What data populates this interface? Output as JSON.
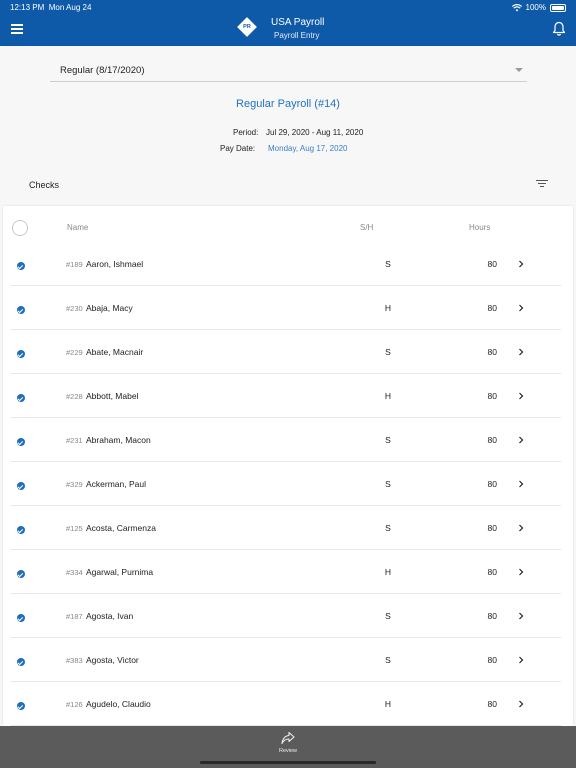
{
  "status_bar": {
    "time": "12:13 PM",
    "date": "Mon Aug 24",
    "battery": "100%"
  },
  "header": {
    "title": "USA Payroll",
    "subtitle": "Payroll Entry",
    "logo_text": "PR"
  },
  "payroll_select": {
    "value": "Regular (8/17/2020)"
  },
  "payroll": {
    "name": "Regular Payroll (#14)",
    "period_label": "Period:",
    "period_value": "Jul 29, 2020 - Aug 11, 2020",
    "paydate_label": "Pay Date:",
    "paydate_value": "Monday, Aug 17, 2020"
  },
  "checks": {
    "label": "Checks",
    "columns": {
      "name": "Name",
      "sh": "S/H",
      "hours": "Hours"
    },
    "rows": [
      {
        "id": "#189",
        "name": "Aaron, Ishmael",
        "sh": "S",
        "hours": "80"
      },
      {
        "id": "#230",
        "name": "Abaja, Macy",
        "sh": "H",
        "hours": "80"
      },
      {
        "id": "#229",
        "name": "Abate, Macnair",
        "sh": "S",
        "hours": "80"
      },
      {
        "id": "#228",
        "name": "Abbott, Mabel",
        "sh": "H",
        "hours": "80"
      },
      {
        "id": "#231",
        "name": "Abraham, Macon",
        "sh": "S",
        "hours": "80"
      },
      {
        "id": "#329",
        "name": "Ackerman, Paul",
        "sh": "S",
        "hours": "80"
      },
      {
        "id": "#125",
        "name": "Acosta, Carmenza",
        "sh": "S",
        "hours": "80"
      },
      {
        "id": "#334",
        "name": "Agarwal, Purnima",
        "sh": "H",
        "hours": "80"
      },
      {
        "id": "#187",
        "name": "Agosta, Ivan",
        "sh": "S",
        "hours": "80"
      },
      {
        "id": "#383",
        "name": "Agosta, Victor",
        "sh": "S",
        "hours": "80"
      },
      {
        "id": "#126",
        "name": "Agudelo, Claudio",
        "sh": "H",
        "hours": "80"
      }
    ]
  },
  "bottom_bar": {
    "review_label": "Review"
  },
  "colors": {
    "header": "#0f5aa8",
    "accent": "#1f73c1",
    "bottom_bar": "#5b5b5b"
  }
}
